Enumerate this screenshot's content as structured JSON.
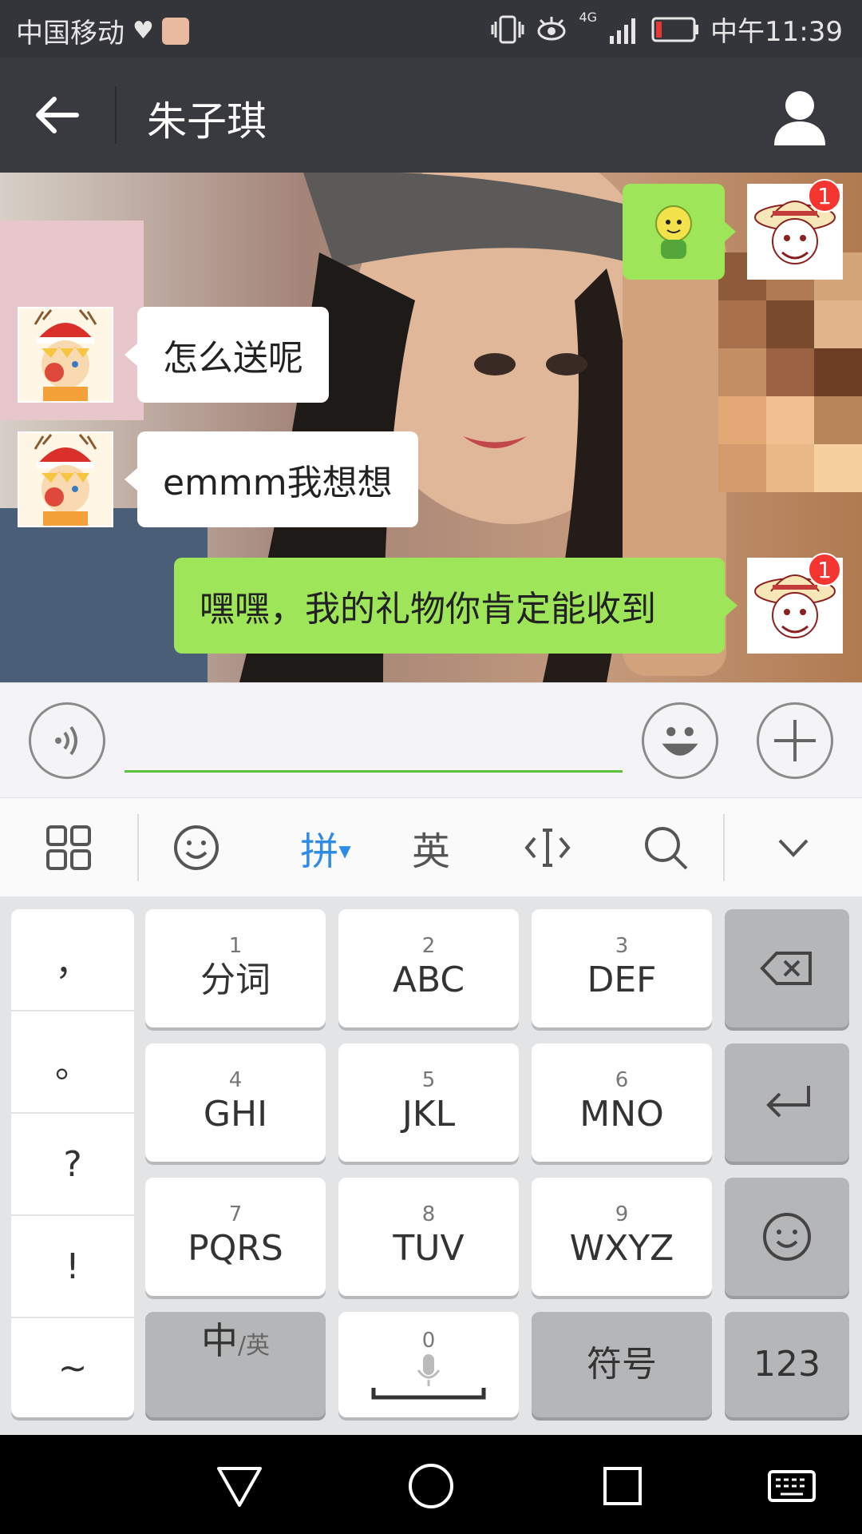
{
  "status": {
    "carrier": "中国移动",
    "network": "4G",
    "time": "中午11:39"
  },
  "header": {
    "title": "朱子琪"
  },
  "messages": [
    {
      "side": "left",
      "text": "怎么送呢"
    },
    {
      "side": "left",
      "text": "emmm我想想"
    },
    {
      "side": "right",
      "text": "嘿嘿，我的礼物你肯定能收到"
    }
  ],
  "badges": {
    "unread_1": "1",
    "unread_2": "1"
  },
  "toolbar": {
    "pinyin": "拼",
    "english": "英"
  },
  "keys": {
    "r1": [
      {
        "num": "1",
        "lab": "分词"
      },
      {
        "num": "2",
        "lab": "ABC"
      },
      {
        "num": "3",
        "lab": "DEF"
      }
    ],
    "r2": [
      {
        "num": "4",
        "lab": "GHI"
      },
      {
        "num": "5",
        "lab": "JKL"
      },
      {
        "num": "6",
        "lab": "MNO"
      }
    ],
    "r3": [
      {
        "num": "7",
        "lab": "PQRS"
      },
      {
        "num": "8",
        "lab": "TUV"
      },
      {
        "num": "9",
        "lab": "WXYZ"
      }
    ],
    "bottom": {
      "lang_main": "中",
      "lang_sub": "/英",
      "space_num": "0",
      "symbols": "符号",
      "numbers": "123"
    }
  },
  "punct": [
    "，",
    "。",
    "?",
    "!",
    "~"
  ],
  "colors": {
    "bubble_right": "#9fe55a",
    "badge": "#f43530",
    "input_line": "#5fbf3e",
    "pinyin_active": "#2e8be6"
  }
}
